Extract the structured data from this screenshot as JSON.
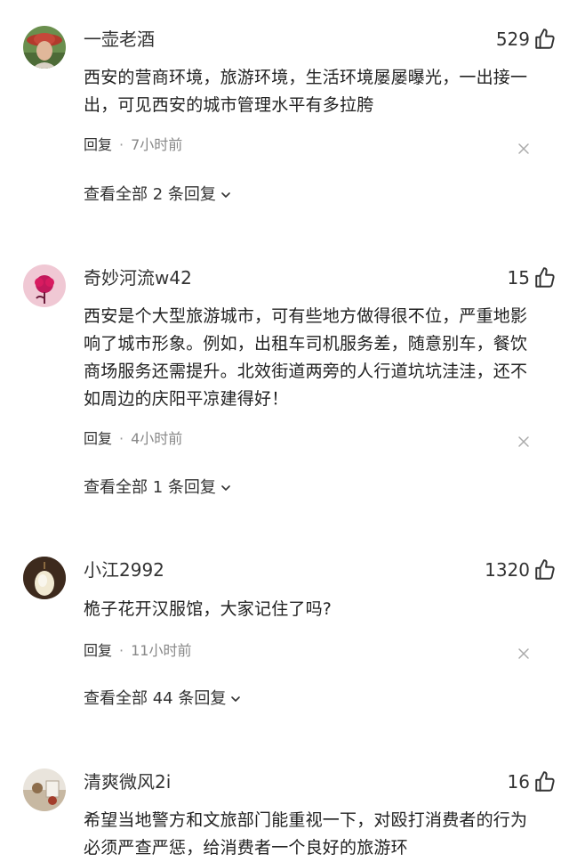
{
  "comments": [
    {
      "username": "一壶老酒",
      "likes": "529",
      "text": "西安的营商环境，旅游环境，生活环境屡屡曝光，一出接一出，可见西安的城市管理水平有多拉胯",
      "reply_label": "回复",
      "separator": "·",
      "time": "7小时前",
      "view_replies": "查看全部 2 条回复"
    },
    {
      "username": "奇妙河流w42",
      "likes": "15",
      "text": "西安是个大型旅游城市，可有些地方做得很不位，严重地影响了城市形象。例如，出租车司机服务差，随意别车，餐饮商场服务还需提升。北效街道两旁的人行道坑坑洼洼，还不如周边的庆阳平凉建得好！",
      "reply_label": "回复",
      "separator": "·",
      "time": "4小时前",
      "view_replies": "查看全部 1 条回复"
    },
    {
      "username": "小江2992",
      "likes": "1320",
      "text": "桅子花开汉服馆，大家记住了吗?",
      "reply_label": "回复",
      "separator": "·",
      "time": "11小时前",
      "view_replies": "查看全部 44 条回复"
    },
    {
      "username": "清爽微风2i",
      "likes": "16",
      "text": "希望当地警方和文旅部门能重视一下，对殴打消费者的行为必须严查严惩，给消费者一个良好的旅游环",
      "reply_label": "",
      "separator": "",
      "time": "",
      "view_replies": ""
    }
  ],
  "icons": {
    "like": "thumbs-up-icon",
    "close": "close-icon",
    "expand": "chevron-down-icon"
  },
  "colors": {
    "text": "#222222",
    "meta": "#888888",
    "icon": "#333333"
  }
}
